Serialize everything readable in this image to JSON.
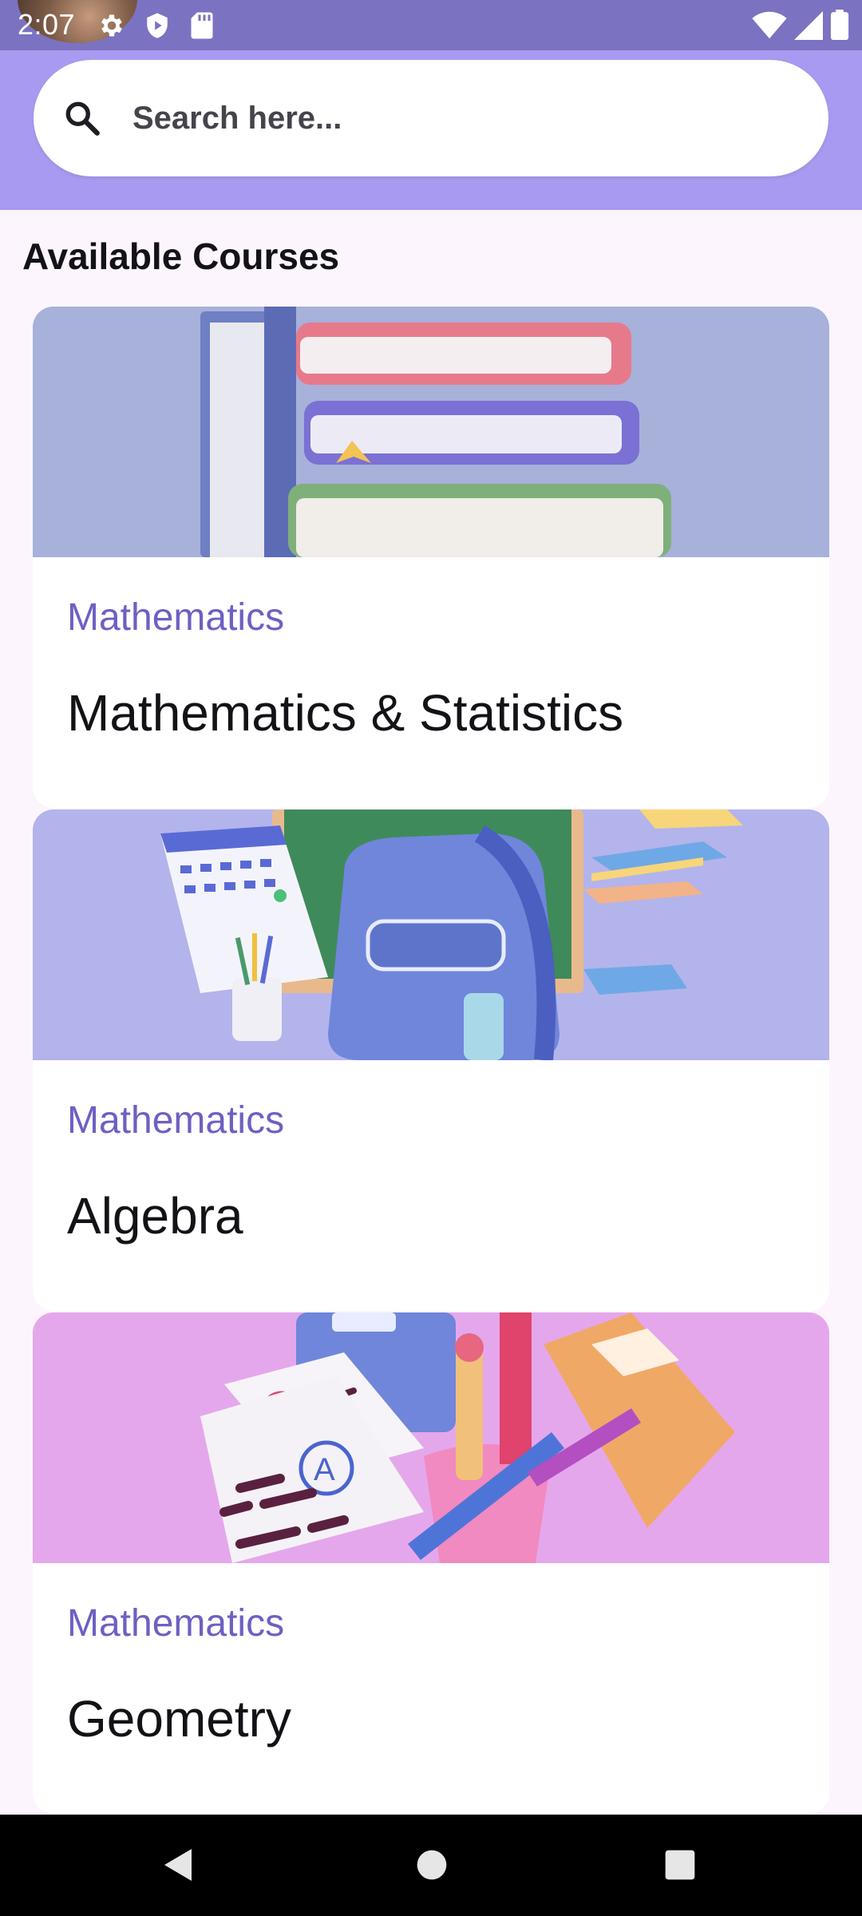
{
  "status_bar": {
    "time": "2:07",
    "icons": [
      "settings-icon",
      "shield-play-icon",
      "sd-card-icon",
      "wifi-icon",
      "signal-icon",
      "battery-icon"
    ],
    "color": "#7b72c2"
  },
  "search": {
    "placeholder": "Search here...",
    "value": "",
    "header_color": "#a79af0"
  },
  "section": {
    "title": "Available Courses"
  },
  "courses": [
    {
      "category": "Mathematics",
      "title": "Mathematics & Statistics",
      "image": "stacked-books-image",
      "image_bg": "#a7b1da"
    },
    {
      "category": "Mathematics",
      "title": "Algebra",
      "image": "school-backpack-image",
      "image_bg": "#b3b4eb"
    },
    {
      "category": "Mathematics",
      "title": "Geometry",
      "image": "stationery-image",
      "image_bg": "#e5a7ec"
    }
  ],
  "colors": {
    "accent": "#6d60c3",
    "background": "#fcf5fd"
  },
  "nav_bar": {
    "buttons": [
      "back-icon",
      "home-icon",
      "recents-icon"
    ]
  }
}
